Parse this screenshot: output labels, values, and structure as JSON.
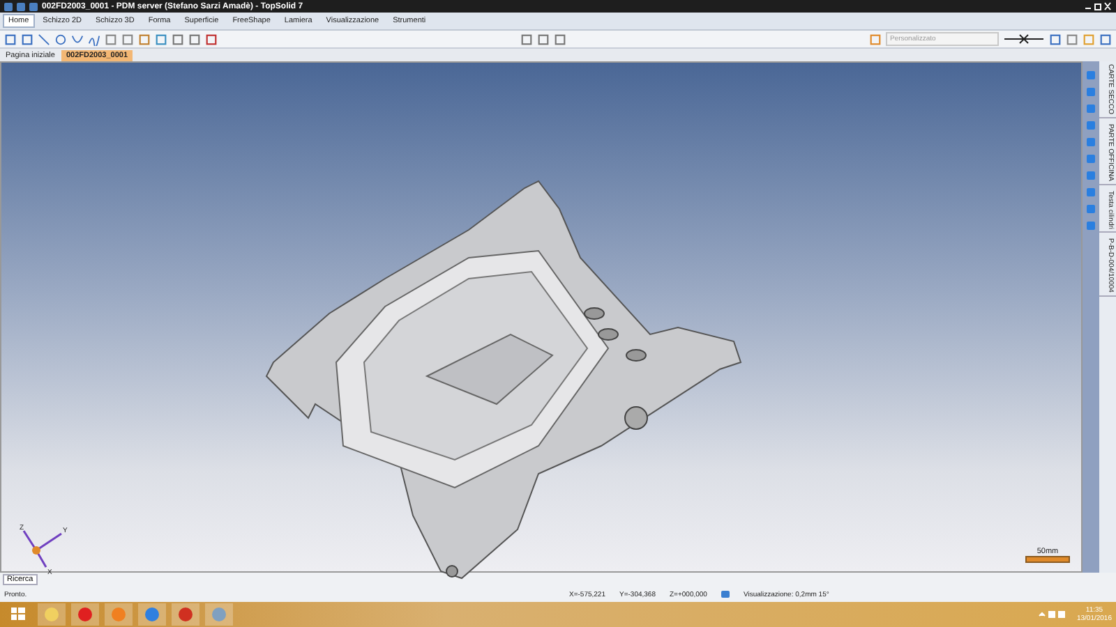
{
  "window": {
    "title": "002FD2003_0001 - PDM server (Stefano Sarzi Amadè) - TopSolid 7"
  },
  "ribbon_tabs": [
    {
      "label": "Home",
      "selected": true
    },
    {
      "label": "Schizzo 2D",
      "selected": false
    },
    {
      "label": "Schizzo 3D",
      "selected": false
    },
    {
      "label": "Forma",
      "selected": false
    },
    {
      "label": "Superficie",
      "selected": false
    },
    {
      "label": "FreeShape",
      "selected": false
    },
    {
      "label": "Lamiera",
      "selected": false
    },
    {
      "label": "Visualizzazione",
      "selected": false
    },
    {
      "label": "Strumenti",
      "selected": false
    }
  ],
  "toolbar": {
    "style_combo": {
      "value": "Personalizzato",
      "disabled": true
    }
  },
  "document_tabs": [
    {
      "label": "Pagina iniziale",
      "selected": false
    },
    {
      "label": "002FD2003_0001",
      "selected": true
    }
  ],
  "side_tabs": [
    {
      "label": "CARTE SECCO"
    },
    {
      "label": "PARTE OFFICINA"
    },
    {
      "label": "Testa cilindri"
    },
    {
      "label": "P-B-D-004/10004"
    }
  ],
  "viewport": {
    "axes": {
      "z": "Z",
      "y": "Y",
      "x": "X"
    },
    "scale": "50mm"
  },
  "search_tab": {
    "label": "Ricerca"
  },
  "status_bar": {
    "message": "Pronto.",
    "x": "X=-575,221",
    "y": "Y=-304,368",
    "z": "Z=+000,000",
    "view": "Visualizzazione: 0,2mm 15°"
  },
  "taskbar": {
    "time": "11:35",
    "date": "13/01/2016"
  }
}
